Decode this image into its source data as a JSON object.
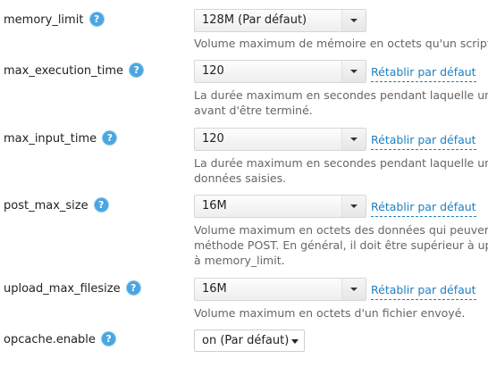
{
  "settings": [
    {
      "name": "memory_limit",
      "value": "128M (Par défaut)",
      "reset_label": "",
      "description": [
        "Volume maximum de mémoire en octets qu'un script p"
      ]
    },
    {
      "name": "max_execution_time",
      "value": "120",
      "reset_label": "Rétablir par défaut",
      "description": [
        "La durée maximum en secondes pendant laquelle un s",
        "avant d'être terminé."
      ]
    },
    {
      "name": "max_input_time",
      "value": "120",
      "reset_label": "Rétablir par défaut",
      "description": [
        "La durée maximum en secondes pendant laquelle un s",
        "données saisies."
      ]
    },
    {
      "name": "post_max_size",
      "value": "16M",
      "reset_label": "Rétablir par défaut",
      "description": [
        "Volume maximum en octets des données qui peuvent",
        "méthode POST. En général, il doit être supérieur à uplo",
        "à memory_limit."
      ]
    },
    {
      "name": "upload_max_filesize",
      "value": "16M",
      "reset_label": "Rétablir par défaut",
      "description": [
        "Volume maximum en octets d'un fichier envoyé."
      ]
    },
    {
      "name": "opcache.enable",
      "value": "on (Par défaut)",
      "reset_label": "",
      "description": []
    }
  ],
  "help_icon_glyph": "?",
  "colors": {
    "accent": "#1e7fc1",
    "help_icon": "#4aa5e0",
    "description_text": "#666666"
  },
  "icons": {
    "help": "question-circle-icon",
    "dropdown": "chevron-down-icon"
  }
}
